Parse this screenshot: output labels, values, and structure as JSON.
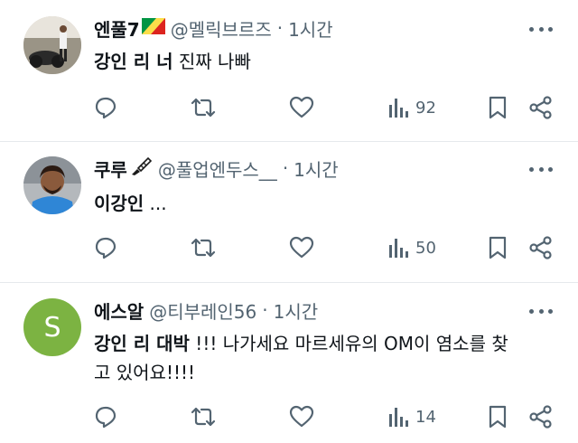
{
  "tweets": [
    {
      "display_name": "엔풀7",
      "handle": "@멜릭브르즈",
      "separator": "·",
      "time": "1시간",
      "text_bold": "강인 리 너",
      "text_rest": " 진짜 나빠",
      "text_line2": "",
      "views": "92",
      "name_emoji": "congo-flag-icon",
      "avatar": "motorcycle-photo-avatar"
    },
    {
      "display_name": "쿠루",
      "handle": "@풀업엔두스__",
      "separator": "·",
      "time": "1시간",
      "text_bold": "이강인",
      "text_rest": " ...",
      "text_line2": "",
      "views": "50",
      "name_emoji": "pen-brush-icon",
      "avatar": "man-photo-avatar"
    },
    {
      "display_name": "에스알",
      "handle": "@티부레인56",
      "separator": "·",
      "time": "1시간",
      "text_bold": "강인 리 대박",
      "text_rest": " !!! 나가세요 마르세유의 OM이 염소를 찾",
      "text_line2": "고 있어요!!!!",
      "views": "14",
      "name_emoji": "",
      "avatar": "letter-avatar",
      "avatar_letter": "S"
    }
  ],
  "colors": {
    "text": "#0f1419",
    "secondary": "#536471",
    "divider": "#e6e9ec",
    "letter_avatar_bg": "#7cb342"
  }
}
